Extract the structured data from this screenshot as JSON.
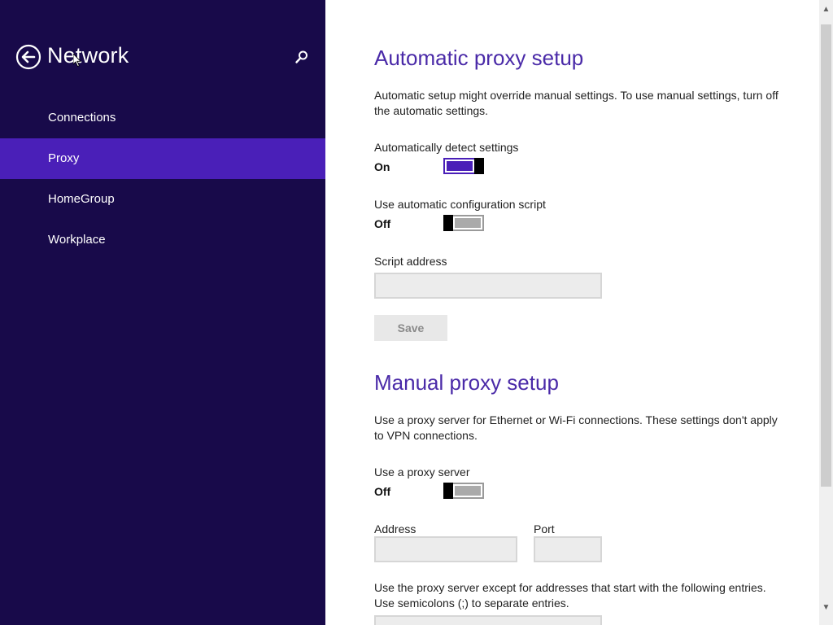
{
  "sidebar": {
    "title": "Network",
    "back_icon": "back-arrow-icon",
    "search_icon": "search-icon",
    "items": [
      {
        "label": "Connections",
        "selected": false
      },
      {
        "label": "Proxy",
        "selected": true
      },
      {
        "label": "HomeGroup",
        "selected": false
      },
      {
        "label": "Workplace",
        "selected": false
      }
    ]
  },
  "automatic": {
    "heading": "Automatic proxy setup",
    "description": "Automatic setup might override manual settings. To use manual settings, turn off the automatic settings.",
    "detect": {
      "label": "Automatically detect settings",
      "state": "On",
      "on": true
    },
    "script": {
      "label": "Use automatic configuration script",
      "state": "Off",
      "on": false
    },
    "address_label": "Script address",
    "address_value": "",
    "save_label": "Save"
  },
  "manual": {
    "heading": "Manual proxy setup",
    "description": "Use a proxy server for Ethernet or Wi-Fi connections. These settings don't apply to VPN connections.",
    "use_proxy": {
      "label": "Use a proxy server",
      "state": "Off",
      "on": false
    },
    "address_label": "Address",
    "address_value": "",
    "port_label": "Port",
    "port_value": "",
    "exceptions_text": "Use the proxy server except for addresses that start with the following entries. Use semicolons (;) to separate entries."
  },
  "colors": {
    "sidebar_bg": "#180a4a",
    "selected_bg": "#4a1fb8",
    "heading": "#4a2aa8",
    "toggle_on": "#4a1fb8"
  }
}
